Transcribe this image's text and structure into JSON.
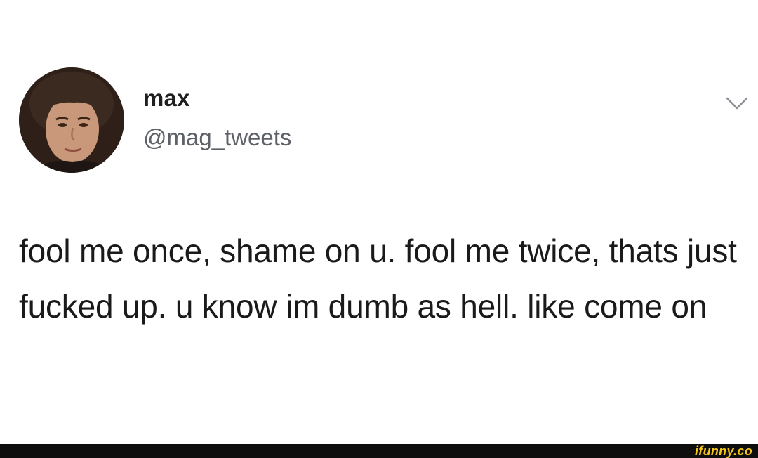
{
  "tweet": {
    "display_name": "max",
    "handle": "@mag_tweets",
    "text": "fool me once, shame on u. fool me twice, thats just fucked up. u know im dumb as hell. like come on",
    "menu_icon": "chevron-down-icon",
    "avatar_icon": "profile-photo"
  },
  "footer": {
    "watermark": "ifunny.co",
    "watermark_color": "#f5c518",
    "background_color": "#0e0e0e"
  }
}
